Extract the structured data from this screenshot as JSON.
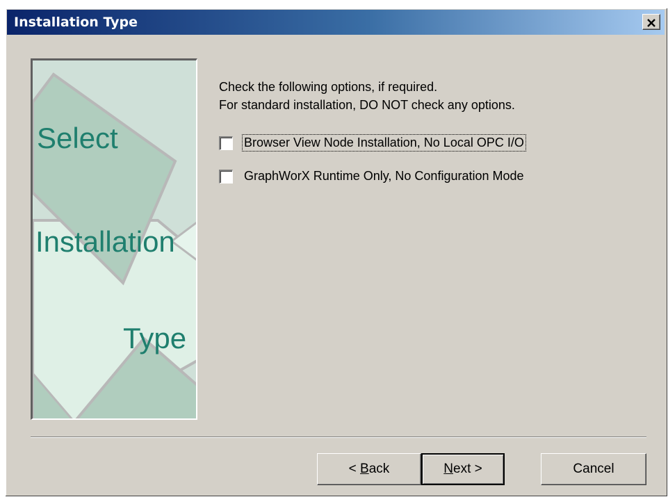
{
  "window": {
    "title": "Installation Type",
    "close_icon": "close-x-icon"
  },
  "side_panel": {
    "words": [
      "Select",
      "Installation",
      "Type"
    ],
    "colors": {
      "text": "#1f7f6e",
      "light": "#dff0e6",
      "dark": "#b0cdbe",
      "bg": "#cfe0d8"
    }
  },
  "instructions": {
    "line1": "Check the following options, if required.",
    "line2": "For standard installation, DO NOT check any options."
  },
  "options": [
    {
      "label": "Browser View Node Installation, No Local OPC I/O",
      "checked": false,
      "focused": true
    },
    {
      "label": "GraphWorX Runtime Only, No Configuration Mode",
      "checked": false,
      "focused": false
    }
  ],
  "buttons": {
    "back": {
      "prefix": "< ",
      "accel": "B",
      "rest": "ack"
    },
    "next": {
      "accel": "N",
      "rest": "ext >"
    },
    "cancel": "Cancel"
  }
}
